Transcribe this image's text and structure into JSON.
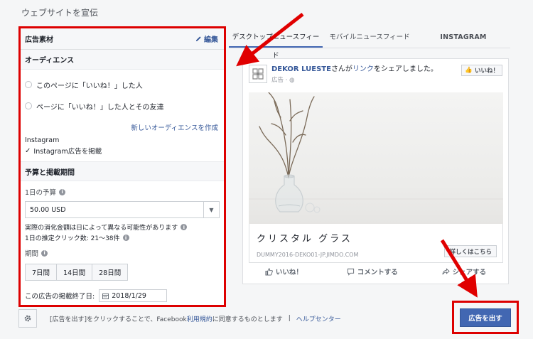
{
  "page_title": "ウェブサイトを宣伝",
  "left_panel": {
    "title": "広告素材",
    "edit_label": "編集",
    "audience": {
      "heading": "オーディエンス",
      "options": [
        "このページに「いいね！」した人",
        "ページに「いいね！」した人とその友達"
      ],
      "new_audience_link": "新しいオーディエンスを作成"
    },
    "instagram": {
      "label": "Instagram",
      "checkbox_label": "Instagram広告を掲載",
      "checked": true
    },
    "budget": {
      "heading": "予算と掲載期間",
      "daily_label": "1日の予算",
      "daily_value": "50.00 USD",
      "note1": "実際の消化金額は日によって異なる可能性があります",
      "note2": "1日の推定クリック数: 21～38件",
      "period_label": "期間",
      "period_options": [
        "7日間",
        "14日間",
        "28日間"
      ],
      "end_label": "この広告の掲載終了日:",
      "end_date": "2018/1/29"
    }
  },
  "tabs": [
    "デスクトップニュースフィード",
    "モバイルニュースフィード",
    "INSTAGRAM"
  ],
  "preview": {
    "page_name": "DEKOR LUESTE",
    "share_text_1": "さんが",
    "share_link": "リンク",
    "share_text_2": "をシェアしました。",
    "sponsored": "広告",
    "like_button": "いいね！",
    "caption_title": "クリスタル グラス",
    "caption_url": "DUMMY2016-DEKO01-JP.JIMDO.COM",
    "cta": "詳しくはこちら",
    "actions": [
      "いいね！",
      "コメントする",
      "シェアする"
    ]
  },
  "footer": {
    "text_prefix": "[広告を出す]をクリックすることで、Facebook",
    "terms_link": "利用規約",
    "text_suffix": "に同意するものとします",
    "separator": "|",
    "help_link": "ヘルプセンター"
  },
  "submit_label": "広告を出す",
  "colors": {
    "highlight_red": "#dd0000",
    "facebook_blue": "#4267b2",
    "link_blue": "#365899"
  }
}
